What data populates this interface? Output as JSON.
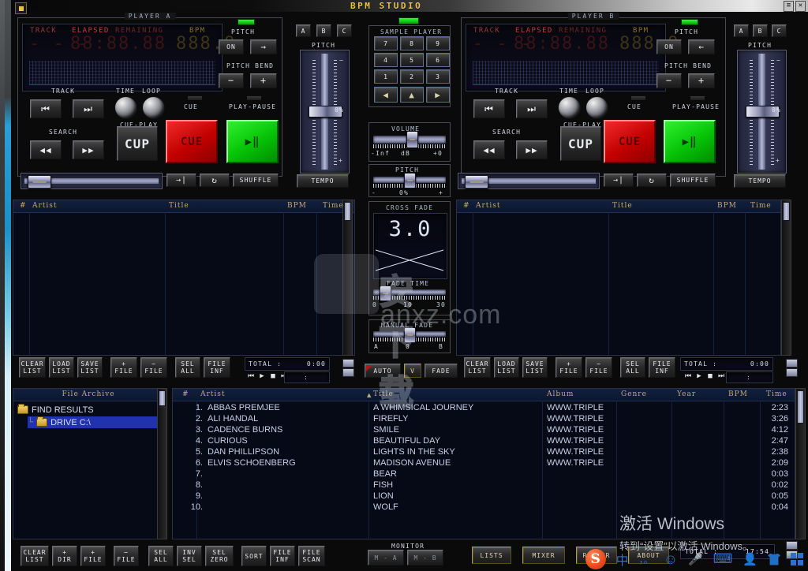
{
  "window": {
    "title": "BPM STUDIO",
    "minimize_label": "≡",
    "close_label": "✕"
  },
  "player_a": {
    "group_label": "PLAYER A",
    "headers": {
      "track": "TRACK",
      "elapsed": "ELAPSED",
      "remaining": "REMAINING",
      "bpm": "BPM"
    },
    "track_value": "- - -",
    "elapsed_value": "88:88.88",
    "bpm_value": "888.8",
    "pitch_label": "PITCH",
    "pitch_on_label": "ON",
    "pitch_dir_label": "→",
    "pitch_bend_label": "PITCH BEND",
    "bend_minus": "−",
    "bend_plus": "+",
    "memory_buttons": [
      "A",
      "B",
      "C"
    ],
    "pitch_slider_label": "PITCH",
    "pitch_value": "0%",
    "pitch_minus": "−",
    "pitch_plus": "+",
    "tempo_label": "TEMPO",
    "track_label": "TRACK",
    "time_label": "TIME",
    "loop_label": "LOOP",
    "search_label": "SEARCH",
    "cue_play_label": "CUE-PLAY",
    "cue_led_label": "CUE",
    "play_led_label": "PLAY-PAUSE",
    "cup_label": "CUP",
    "cue_label": "CUE",
    "play_label": "▶‖",
    "prev_label": "⏮",
    "next_label": "⏭",
    "rew_label": "◀◀",
    "ffw_label": "▶▶",
    "single_label": "→|",
    "loop_btn_label": "↻",
    "shuffle_label": "SHUFFLE"
  },
  "player_b": {
    "group_label": "PLAYER B",
    "headers": {
      "track": "TRACK",
      "elapsed": "ELAPSED",
      "remaining": "REMAINING",
      "bpm": "BPM"
    },
    "track_value": "- - -",
    "elapsed_value": "88:88.88",
    "bpm_value": "888.8",
    "pitch_label": "PITCH",
    "pitch_on_label": "ON",
    "pitch_dir_label": "←",
    "pitch_bend_label": "PITCH BEND",
    "bend_minus": "−",
    "bend_plus": "+",
    "memory_buttons": [
      "A",
      "B",
      "C"
    ],
    "pitch_slider_label": "PITCH",
    "pitch_value": "0%",
    "pitch_minus": "−",
    "pitch_plus": "+",
    "tempo_label": "TEMPO",
    "track_label": "TRACK",
    "time_label": "TIME",
    "loop_label": "LOOP",
    "search_label": "SEARCH",
    "cue_play_label": "CUE-PLAY",
    "cue_led_label": "CUE",
    "play_led_label": "PLAY-PAUSE",
    "cup_label": "CUP",
    "cue_label": "CUE",
    "play_label": "▶‖",
    "prev_label": "⏮",
    "next_label": "⏭",
    "rew_label": "◀◀",
    "ffw_label": "▶▶",
    "single_label": "→|",
    "loop_btn_label": "↻",
    "shuffle_label": "SHUFFLE"
  },
  "sample_player": {
    "title": "SAMPLE PLAYER",
    "pads": [
      "7",
      "8",
      "9",
      "4",
      "5",
      "6",
      "1",
      "2",
      "3"
    ],
    "nav": [
      "◀",
      "▲",
      "▶"
    ],
    "volume_label": "VOLUME",
    "volume_min": "-Inf",
    "volume_unit": "dB",
    "volume_max": "+0",
    "pitch_label": "PITCH",
    "pitch_min": "-",
    "pitch_value": "0%",
    "pitch_max": "+"
  },
  "crossfade": {
    "title": "CROSS FADE",
    "value": "3.0",
    "fade_time_label": "FADE TIME",
    "fade_time_min": "0",
    "fade_time_mid": "10",
    "fade_time_max": "30",
    "manual_fade_label": "MANUAL FADE",
    "manual_a": "A",
    "manual_0": "0",
    "manual_b": "B",
    "auto_label": "AUTO",
    "v_label": "V",
    "fade_label": "FADE"
  },
  "playlist_a": {
    "columns": [
      "#",
      "Artist",
      "Title",
      "BPM",
      "Time"
    ],
    "rows": [],
    "controls": [
      {
        "l1": "CLEAR",
        "l2": "LIST"
      },
      {
        "l1": "LOAD",
        "l2": "LIST"
      },
      {
        "l1": "SAVE",
        "l2": "LIST"
      },
      {
        "l1": "+",
        "l2": "FILE"
      },
      {
        "l1": "−",
        "l2": "FILE"
      },
      {
        "l1": "SEL",
        "l2": "ALL"
      },
      {
        "l1": "FILE",
        "l2": "INF"
      }
    ],
    "total_label": "TOTAL :",
    "total_value": "0:00",
    "transport": [
      "⏮",
      "▶",
      "■",
      "⏭"
    ],
    "time_value": ":"
  },
  "playlist_b": {
    "columns": [
      "#",
      "Artist",
      "Title",
      "BPM",
      "Time"
    ],
    "rows": [],
    "controls": [
      {
        "l1": "CLEAR",
        "l2": "LIST"
      },
      {
        "l1": "LOAD",
        "l2": "LIST"
      },
      {
        "l1": "SAVE",
        "l2": "LIST"
      },
      {
        "l1": "+",
        "l2": "FILE"
      },
      {
        "l1": "−",
        "l2": "FILE"
      },
      {
        "l1": "SEL",
        "l2": "ALL"
      },
      {
        "l1": "FILE",
        "l2": "INF"
      }
    ],
    "total_label": "TOTAL :",
    "total_value": "0:00",
    "transport": [
      "⏮",
      "▶",
      "■",
      "⏭"
    ],
    "time_value": ":"
  },
  "file_archive": {
    "title": "File Archive",
    "nodes": [
      {
        "label": "FIND RESULTS",
        "icon": "folder-icon",
        "selected": false
      },
      {
        "label": "DRIVE C:\\",
        "icon": "drive-icon",
        "selected": true
      }
    ]
  },
  "browser": {
    "columns": [
      "#",
      "Artist",
      "Title",
      "Album",
      "Genre",
      "Year",
      "BPM",
      "Time"
    ],
    "sort_indicator": "▲",
    "rows": [
      {
        "num": "1.",
        "artist": "ABBAS PREMJEE",
        "title": "A WHIMSICAL JOURNEY",
        "album": "WWW.TRIPLE",
        "genre": "",
        "year": "",
        "bpm": "",
        "time": "2:23"
      },
      {
        "num": "2.",
        "artist": "ALI HANDAL",
        "title": "FIREFLY",
        "album": "WWW.TRIPLE",
        "genre": "",
        "year": "",
        "bpm": "",
        "time": "3:26"
      },
      {
        "num": "3.",
        "artist": "CADENCE BURNS",
        "title": "SMILE",
        "album": "WWW.TRIPLE",
        "genre": "",
        "year": "",
        "bpm": "",
        "time": "4:12"
      },
      {
        "num": "4.",
        "artist": "CURIOUS",
        "title": "BEAUTIFUL DAY",
        "album": "WWW.TRIPLE",
        "genre": "",
        "year": "",
        "bpm": "",
        "time": "2:47"
      },
      {
        "num": "5.",
        "artist": "DAN PHILLIPSON",
        "title": "LIGHTS IN THE SKY",
        "album": "WWW.TRIPLE",
        "genre": "",
        "year": "",
        "bpm": "",
        "time": "2:38"
      },
      {
        "num": "6.",
        "artist": "ELVIS SCHOENBERG",
        "title": "MADISON AVENUE",
        "album": "WWW.TRIPLE",
        "genre": "",
        "year": "",
        "bpm": "",
        "time": "2:09"
      },
      {
        "num": "7.",
        "artist": "",
        "title": "BEAR",
        "album": "",
        "genre": "",
        "year": "",
        "bpm": "",
        "time": "0:03"
      },
      {
        "num": "8.",
        "artist": "",
        "title": "FISH",
        "album": "",
        "genre": "",
        "year": "",
        "bpm": "",
        "time": "0:02"
      },
      {
        "num": "9.",
        "artist": "",
        "title": "LION",
        "album": "",
        "genre": "",
        "year": "",
        "bpm": "",
        "time": "0:05"
      },
      {
        "num": "10.",
        "artist": "",
        "title": "WOLF",
        "album": "",
        "genre": "",
        "year": "",
        "bpm": "",
        "time": "0:04"
      }
    ]
  },
  "bottom_bar": {
    "left_controls": [
      {
        "l1": "CLEAR",
        "l2": "LIST"
      },
      {
        "l1": "+",
        "l2": "DIR"
      },
      {
        "l1": "+",
        "l2": "FILE"
      },
      {
        "l1": "−",
        "l2": "FILE"
      }
    ],
    "sel_controls": [
      {
        "l1": "SEL",
        "l2": "ALL"
      },
      {
        "l1": "INV",
        "l2": "SEL"
      },
      {
        "l1": "SEL",
        "l2": "ZERO"
      }
    ],
    "tool_controls": [
      {
        "l1": "SORT",
        "l2": ""
      },
      {
        "l1": "FILE",
        "l2": "INF"
      },
      {
        "l1": "FILE",
        "l2": "SCAN"
      }
    ],
    "monitor_label": "MONITOR",
    "monitor_buttons": [
      "M - A",
      "M - B"
    ],
    "main_buttons": [
      "LISTS",
      "MIXER",
      "RIPPER",
      "ABOUT"
    ],
    "total_label": "TOTAL :",
    "total_value": "17:54"
  },
  "watermark": {
    "text": "安下载",
    "domain": "anxz.com"
  },
  "windows_activation": {
    "line1": "激活 Windows",
    "line2": "转到“设置”以激活 Windows。"
  },
  "ime": {
    "logo": "S",
    "mode": "中",
    "punct": "，。",
    "emoji": "☺",
    "mic": "⬤",
    "keyboard": "⌨",
    "user": "⚲",
    "skin": "skin-icon",
    "more": "more-icon"
  },
  "colors": {
    "gold": "#e8c54a",
    "cue_red": "#c20000",
    "play_green": "#06c206",
    "select_blue": "#2032b0",
    "header_tan": "#c8a878"
  }
}
